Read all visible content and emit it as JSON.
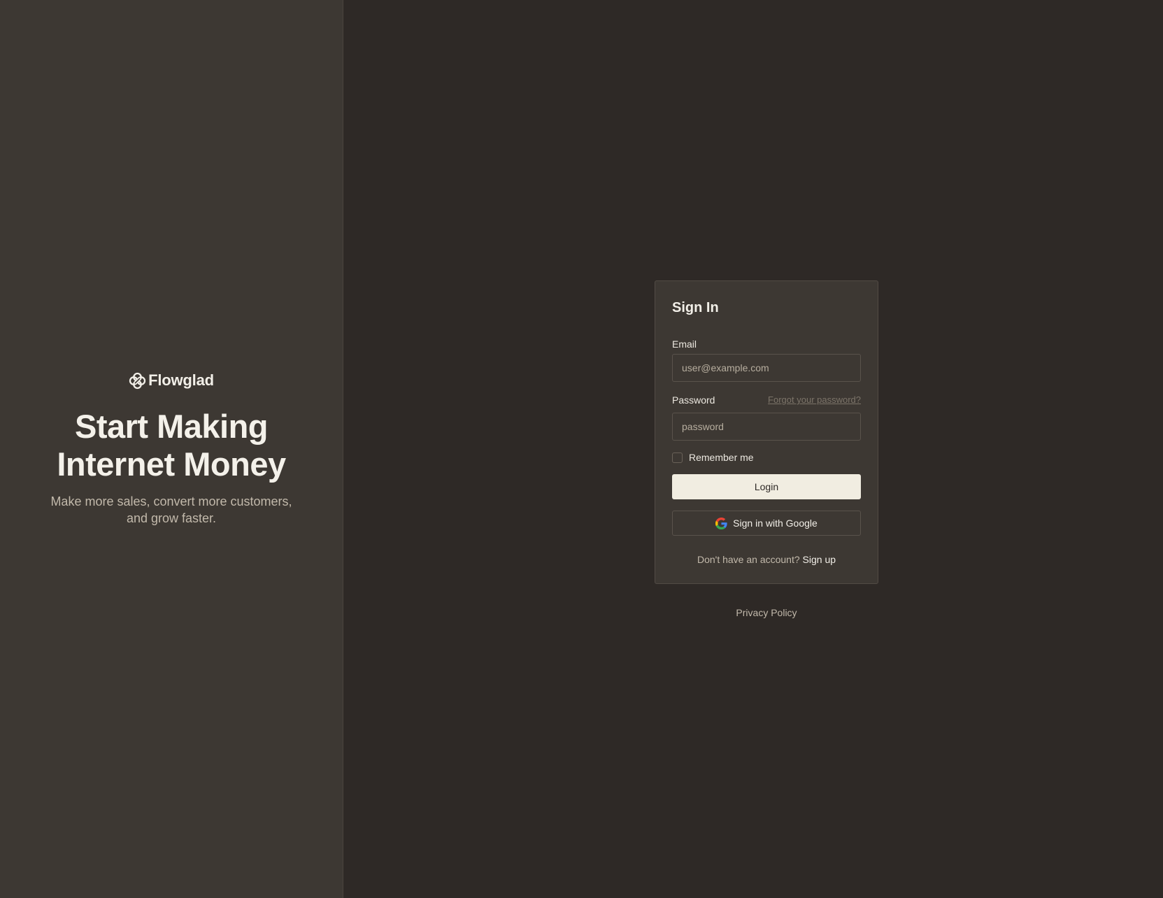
{
  "brand": {
    "name": "Flowglad",
    "icon": "flowglad-logo-icon"
  },
  "hero": {
    "title": "Start Making Internet Money",
    "subtitle": "Make more sales, convert more customers, and grow faster."
  },
  "signin": {
    "title": "Sign In",
    "email": {
      "label": "Email",
      "placeholder": "user@example.com",
      "value": ""
    },
    "password": {
      "label": "Password",
      "placeholder": "password",
      "value": "",
      "forgot_label": "Forgot your password?"
    },
    "remember": {
      "label": "Remember me",
      "checked": false
    },
    "login_label": "Login",
    "google_label": "Sign in with Google",
    "google_icon": "google-icon",
    "signup_prompt": "Don't have an account?",
    "signup_label": "Sign up"
  },
  "footer": {
    "privacy_label": "Privacy Policy"
  },
  "colors": {
    "left_panel_bg": "#3d3833",
    "page_bg": "#2e2926",
    "card_bg": "#3d3833",
    "login_button_bg": "#f1ede1",
    "text_primary": "#f2efe8",
    "text_muted": "#c2b9ab"
  }
}
